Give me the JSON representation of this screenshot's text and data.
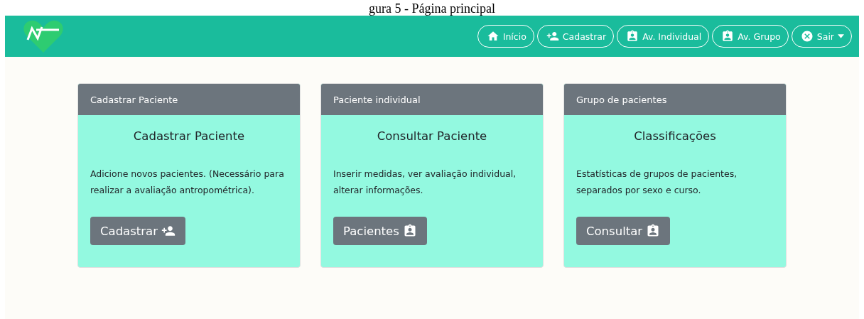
{
  "caption": "gura 5 - Página principal",
  "nav": {
    "items": [
      {
        "label": "Início",
        "kind": "home"
      },
      {
        "label": "Cadastrar",
        "kind": "register"
      },
      {
        "label": "Av. Individual",
        "kind": "individual"
      },
      {
        "label": "Av. Grupo",
        "kind": "group"
      },
      {
        "label": "Sair",
        "kind": "exit",
        "dropdown": true
      }
    ]
  },
  "cards": [
    {
      "header": "Cadastrar Paciente",
      "title": "Cadastrar Paciente",
      "text": "Adicione novos pacientes. (Necessário para realizar a avaliação antropométrica).",
      "button": "Cadastrar",
      "kind": "register"
    },
    {
      "header": "Paciente individual",
      "title": "Consultar Paciente",
      "text": "Inserir medidas, ver avaliação individual, alterar informações.",
      "button": "Pacientes",
      "kind": "individual"
    },
    {
      "header": "Grupo de pacientes",
      "title": "Classificações",
      "text": "Estatísticas de grupos de pacientes, separados por sexo e curso.",
      "button": "Consultar",
      "kind": "group"
    }
  ]
}
